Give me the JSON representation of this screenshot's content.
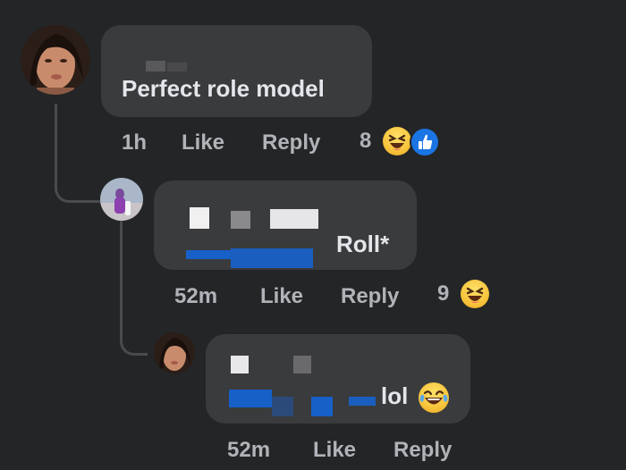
{
  "comments": [
    {
      "text": "Perfect role model",
      "time": "1h",
      "like_label": "Like",
      "reply_label": "Reply",
      "reaction_count": "8",
      "reactions": [
        "haha-emoji-icon",
        "like-reaction-icon"
      ]
    },
    {
      "text": "Roll*",
      "time": "52m",
      "like_label": "Like",
      "reply_label": "Reply",
      "reaction_count": "9",
      "reactions": [
        "haha-emoji-icon"
      ]
    },
    {
      "text": "lol",
      "time": "52m",
      "like_label": "Like",
      "reply_label": "Reply",
      "reactions": [
        "tears-of-joy-emoji-icon"
      ]
    }
  ],
  "colors": {
    "background": "#242526",
    "bubble": "#3a3b3c",
    "text": "#e4e6eb",
    "meta": "#b0b3b8",
    "like_blue": "#1b74e4",
    "emoji_yellow": "#f7c43c"
  }
}
